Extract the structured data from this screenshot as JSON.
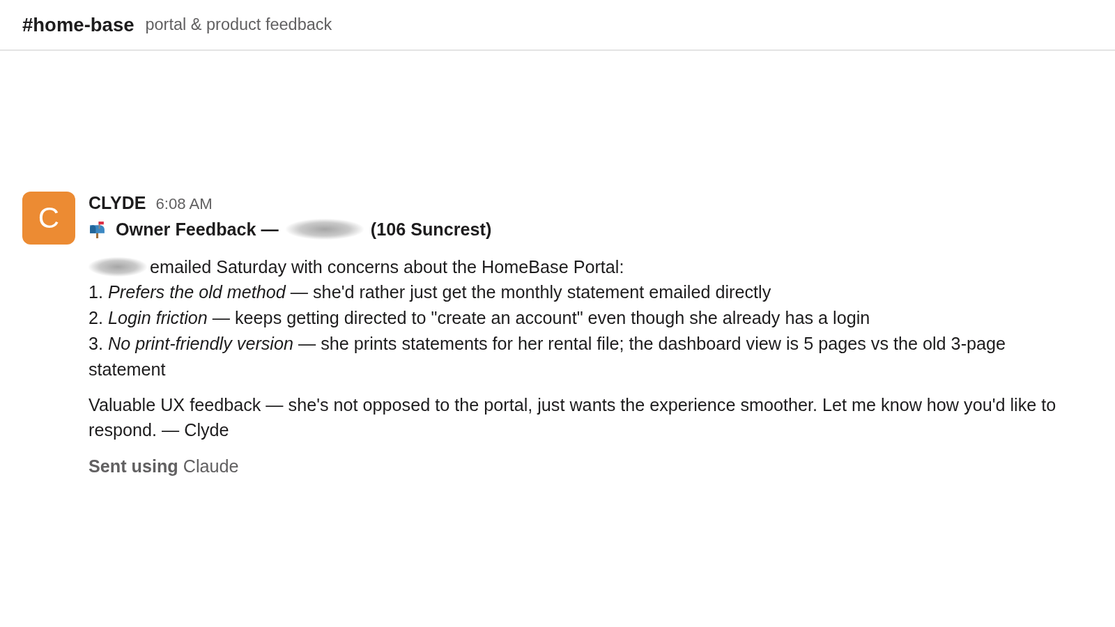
{
  "channel": {
    "name": "#home-base",
    "topic": "portal & product feedback"
  },
  "message": {
    "avatar": {
      "initial": "C"
    },
    "author": "CLYDE",
    "time": "6:08 AM",
    "title_parts": [
      {
        "kind": "text",
        "text": "Owner Feedback —"
      },
      {
        "kind": "redacted"
      },
      {
        "kind": "text",
        "text": "(106 Suncrest)"
      }
    ],
    "intro_parts": [
      {
        "kind": "redacted"
      },
      {
        "kind": "text",
        "text": "emailed Saturday with concerns about the HomeBase Portal:"
      }
    ],
    "items": [
      "1. *Prefers the old method* — she'd rather just get the monthly statement emailed directly",
      "2. *Login friction* — keeps getting directed to \"create an account\" even though she already has a login",
      "3. *No print-friendly version* — she prints statements for her rental file; the dashboard view is 5 pages vs the old 3-page statement"
    ],
    "closing": "Valuable UX feedback — she's not opposed to the portal, just wants the experience smoother. Let me know how you'd like to respond. — Clyde",
    "footer": "**Sent using** Claude"
  }
}
